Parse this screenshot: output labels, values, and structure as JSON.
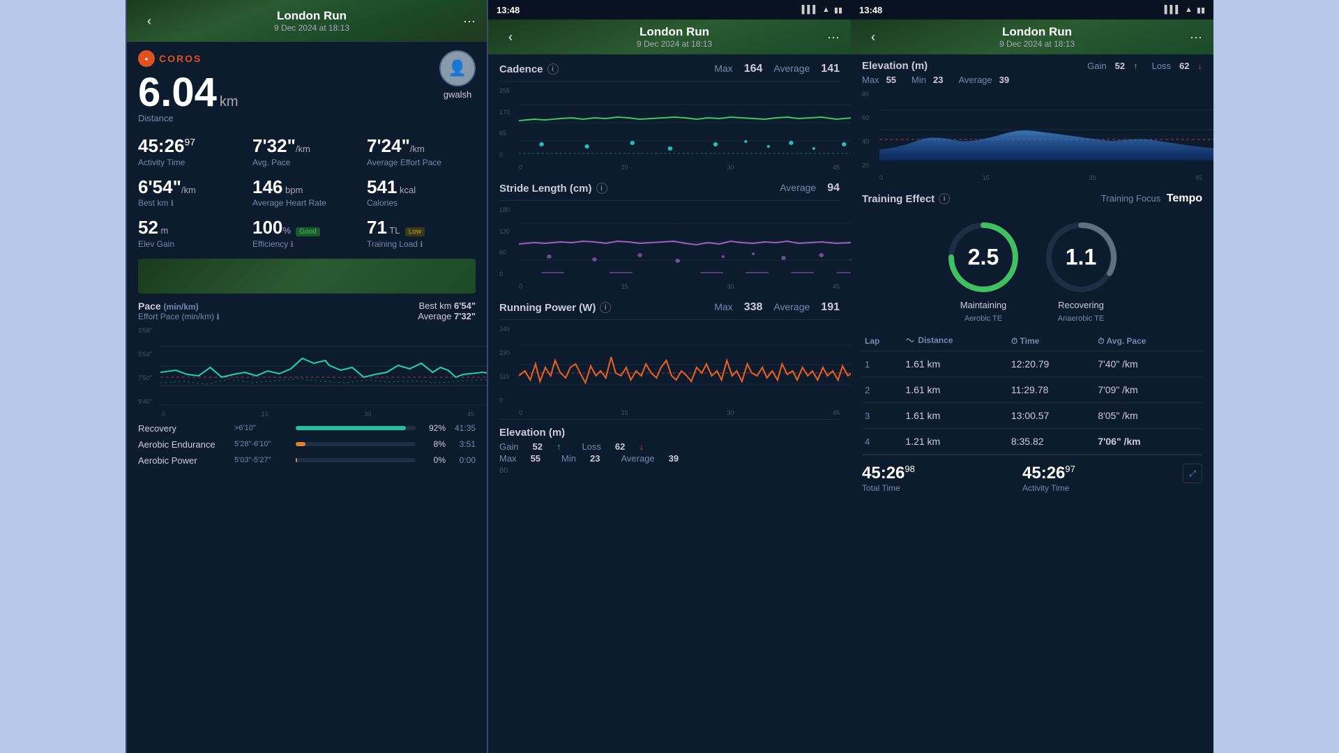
{
  "panel1": {
    "header": {
      "title": "London Run",
      "subtitle": "9 Dec 2024 at 18:13",
      "back_label": "‹",
      "more_label": "···"
    },
    "brand": "COROS",
    "distance": {
      "value": "6.04",
      "unit": "km",
      "label": "Distance"
    },
    "user": {
      "name": "gwalsh"
    },
    "stats": [
      {
        "value": "45:26",
        "sup": "97",
        "label": "Activity Time"
      },
      {
        "value": "7'32\"",
        "unit": "/km",
        "label": "Avg. Pace"
      },
      {
        "value": "7'24\"",
        "unit": "/km",
        "label": "Average Effort Pace"
      },
      {
        "value": "6'54\"",
        "unit": "/km",
        "label": "Best km"
      },
      {
        "value": "146",
        "unit": "bpm",
        "label": "Average Heart Rate"
      },
      {
        "value": "541",
        "unit": "kcal",
        "label": "Calories"
      },
      {
        "value": "52",
        "unit": "m",
        "label": "Elev Gain"
      },
      {
        "value": "100",
        "unit": "%",
        "badge": "Good",
        "label": "Efficiency"
      },
      {
        "value": "71",
        "unit": "TL",
        "badge": "Low",
        "label": "Training Load"
      }
    ],
    "pace_chart": {
      "title": "Pace",
      "title2": "(min/km)",
      "subtitle": "Effort Pace (min/km)",
      "best_label": "Best km",
      "best_val": "6'54\"",
      "avg_label": "Average",
      "avg_val": "7'32\"",
      "y_labels": [
        "3'58\"",
        "5'54\"",
        "7'50\"",
        "9'46\""
      ],
      "x_labels": [
        "0",
        "15",
        "30",
        "45"
      ]
    },
    "recovery": [
      {
        "label": "Recovery",
        "range": ">6'10\"",
        "pct": "92%",
        "time": "41:35",
        "fill": "#20c0a0",
        "fill_pct": 92
      },
      {
        "label": "Aerobic Endurance",
        "range": "5'28\"-6'10\"",
        "pct": "8%",
        "time": "3:51",
        "fill": "#e08030",
        "fill_pct": 8
      },
      {
        "label": "Aerobic Power",
        "range": "5'03\"-5'27\"",
        "pct": "0%",
        "time": "0:00",
        "fill": "#e08030",
        "fill_pct": 0
      }
    ]
  },
  "panel2": {
    "status_time": "13:48",
    "header": {
      "title": "London Run",
      "subtitle": "9 Dec 2024 at 18:13"
    },
    "cadence": {
      "title": "Cadence",
      "max_label": "Max",
      "max_val": "164",
      "avg_label": "Average",
      "avg_val": "141",
      "y_labels": [
        "255",
        "170",
        "85",
        "0"
      ],
      "x_labels": [
        "0",
        "15",
        "30",
        "45"
      ]
    },
    "stride": {
      "title": "Stride Length (cm)",
      "avg_label": "Average",
      "avg_val": "94",
      "y_labels": [
        "180",
        "120",
        "60",
        "0"
      ],
      "x_labels": [
        "0",
        "15",
        "30",
        "45"
      ]
    },
    "running_power": {
      "title": "Running Power (W)",
      "max_label": "Max",
      "max_val": "338",
      "avg_label": "Average",
      "avg_val": "191",
      "y_labels": [
        "345",
        "230",
        "115",
        "0"
      ],
      "x_labels": [
        "0",
        "15",
        "30",
        "45"
      ]
    },
    "elevation": {
      "title": "Elevation (m)",
      "gain_label": "Gain",
      "gain_val": "52",
      "loss_label": "Loss",
      "loss_val": "62",
      "max_label": "Max",
      "max_val": "55",
      "min_label": "Min",
      "min_val": "23",
      "avg_label": "Average",
      "avg_val": "39",
      "y_val": "80"
    }
  },
  "panel3": {
    "status_time": "13:48",
    "header": {
      "title": "London Run",
      "subtitle": "9 Dec 2024 at 18:13"
    },
    "elevation": {
      "title": "Elevation (m)",
      "gain_label": "Gain",
      "gain_val": "52",
      "loss_label": "Loss",
      "loss_val": "62",
      "max_label": "Max",
      "max_val": "55",
      "min_label": "Min",
      "min_val": "23",
      "avg_label": "Average",
      "avg_val": "39",
      "y_labels": [
        "80",
        "60",
        "40",
        "20"
      ],
      "x_labels": [
        "0",
        "15",
        "30",
        "45"
      ]
    },
    "training_effect": {
      "title": "Training Effect",
      "focus_label": "Training Focus",
      "focus_val": "Tempo",
      "aerobic": {
        "value": "2.5",
        "label1": "Maintaining",
        "label2": "Aerobic TE"
      },
      "anaerobic": {
        "value": "1.1",
        "label1": "Recovering",
        "label2": "Anaerobic TE"
      }
    },
    "laps": {
      "headers": [
        "Lap",
        "Distance",
        "Time",
        "Avg. Pace"
      ],
      "rows": [
        {
          "lap": "1",
          "distance": "1.61 km",
          "time": "12:20.79",
          "pace": "7'40\" /km",
          "highlight": false
        },
        {
          "lap": "2",
          "distance": "1.61 km",
          "time": "11:29.78",
          "pace": "7'09\" /km",
          "highlight": false
        },
        {
          "lap": "3",
          "distance": "1.61 km",
          "time": "13:00.57",
          "pace": "8'05\" /km",
          "highlight": false
        },
        {
          "lap": "4",
          "distance": "1.21 km",
          "time": "8:35.82",
          "pace": "7'06\" /km",
          "highlight": true
        }
      ]
    },
    "totals": {
      "total_time_label": "Total Time",
      "total_time_val": "45:26",
      "total_time_sup": "98",
      "activity_time_label": "Activity Time",
      "activity_time_val": "45:26",
      "activity_time_sup": "97"
    }
  },
  "colors": {
    "accent_teal": "#20c0a0",
    "accent_blue": "#40a0e0",
    "accent_orange": "#e08030",
    "accent_red": "#e04040",
    "accent_purple": "#a060c0",
    "dark_bg": "#0d1b2e",
    "card_bg": "#111e30",
    "border": "#1e2f45",
    "text_primary": "#ffffff",
    "text_secondary": "#7788aa",
    "good_green": "#40c060",
    "low_yellow": "#c0a030"
  }
}
